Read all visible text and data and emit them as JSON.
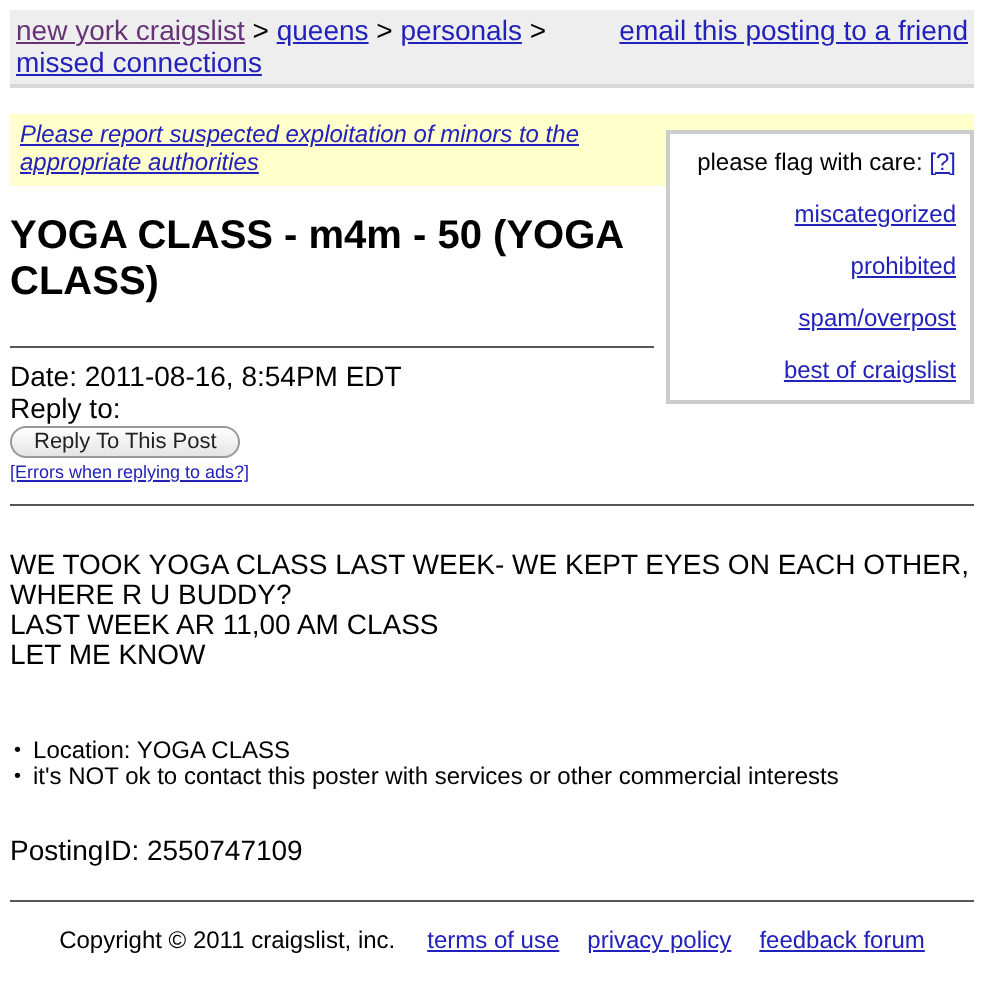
{
  "breadcrumbs": [
    {
      "label": "new york craigslist",
      "visited": true
    },
    {
      "label": "queens",
      "visited": false
    },
    {
      "label": "personals",
      "visited": false
    },
    {
      "label": "missed connections",
      "visited": false
    }
  ],
  "separator": ">",
  "email_link": "email this posting to a friend",
  "notice": "Please report suspected exploitation of minors to the appropriate authorities",
  "flag_box": {
    "heading": "please flag with care:",
    "help": "[?]",
    "links": [
      "miscategorized",
      "prohibited",
      "spam/overpost",
      "best of craigslist"
    ]
  },
  "title": "YOGA CLASS - m4m - 50 (YOGA CLASS)",
  "date": "Date: 2011-08-16, 8:54PM EDT",
  "reply_to": "Reply to:",
  "reply_button": "Reply To This Post",
  "errors_link": "[Errors when replying to ads?]",
  "body_lines": [
    "WE TOOK YOGA CLASS LAST WEEK- WE KEPT EYES ON EACH OTHER, WHERE R U BUDDY?",
    "LAST WEEK AR 11,00 AM CLASS",
    "LET ME KNOW"
  ],
  "bullet": "•",
  "details": [
    "Location: YOGA CLASS",
    "it's NOT ok to contact this poster with services or other commercial interests"
  ],
  "posting_id": "PostingID: 2550747109",
  "footer": {
    "copyright": "Copyright © 2011 craigslist, inc.",
    "links": [
      "terms of use",
      "privacy policy",
      "feedback forum"
    ]
  }
}
